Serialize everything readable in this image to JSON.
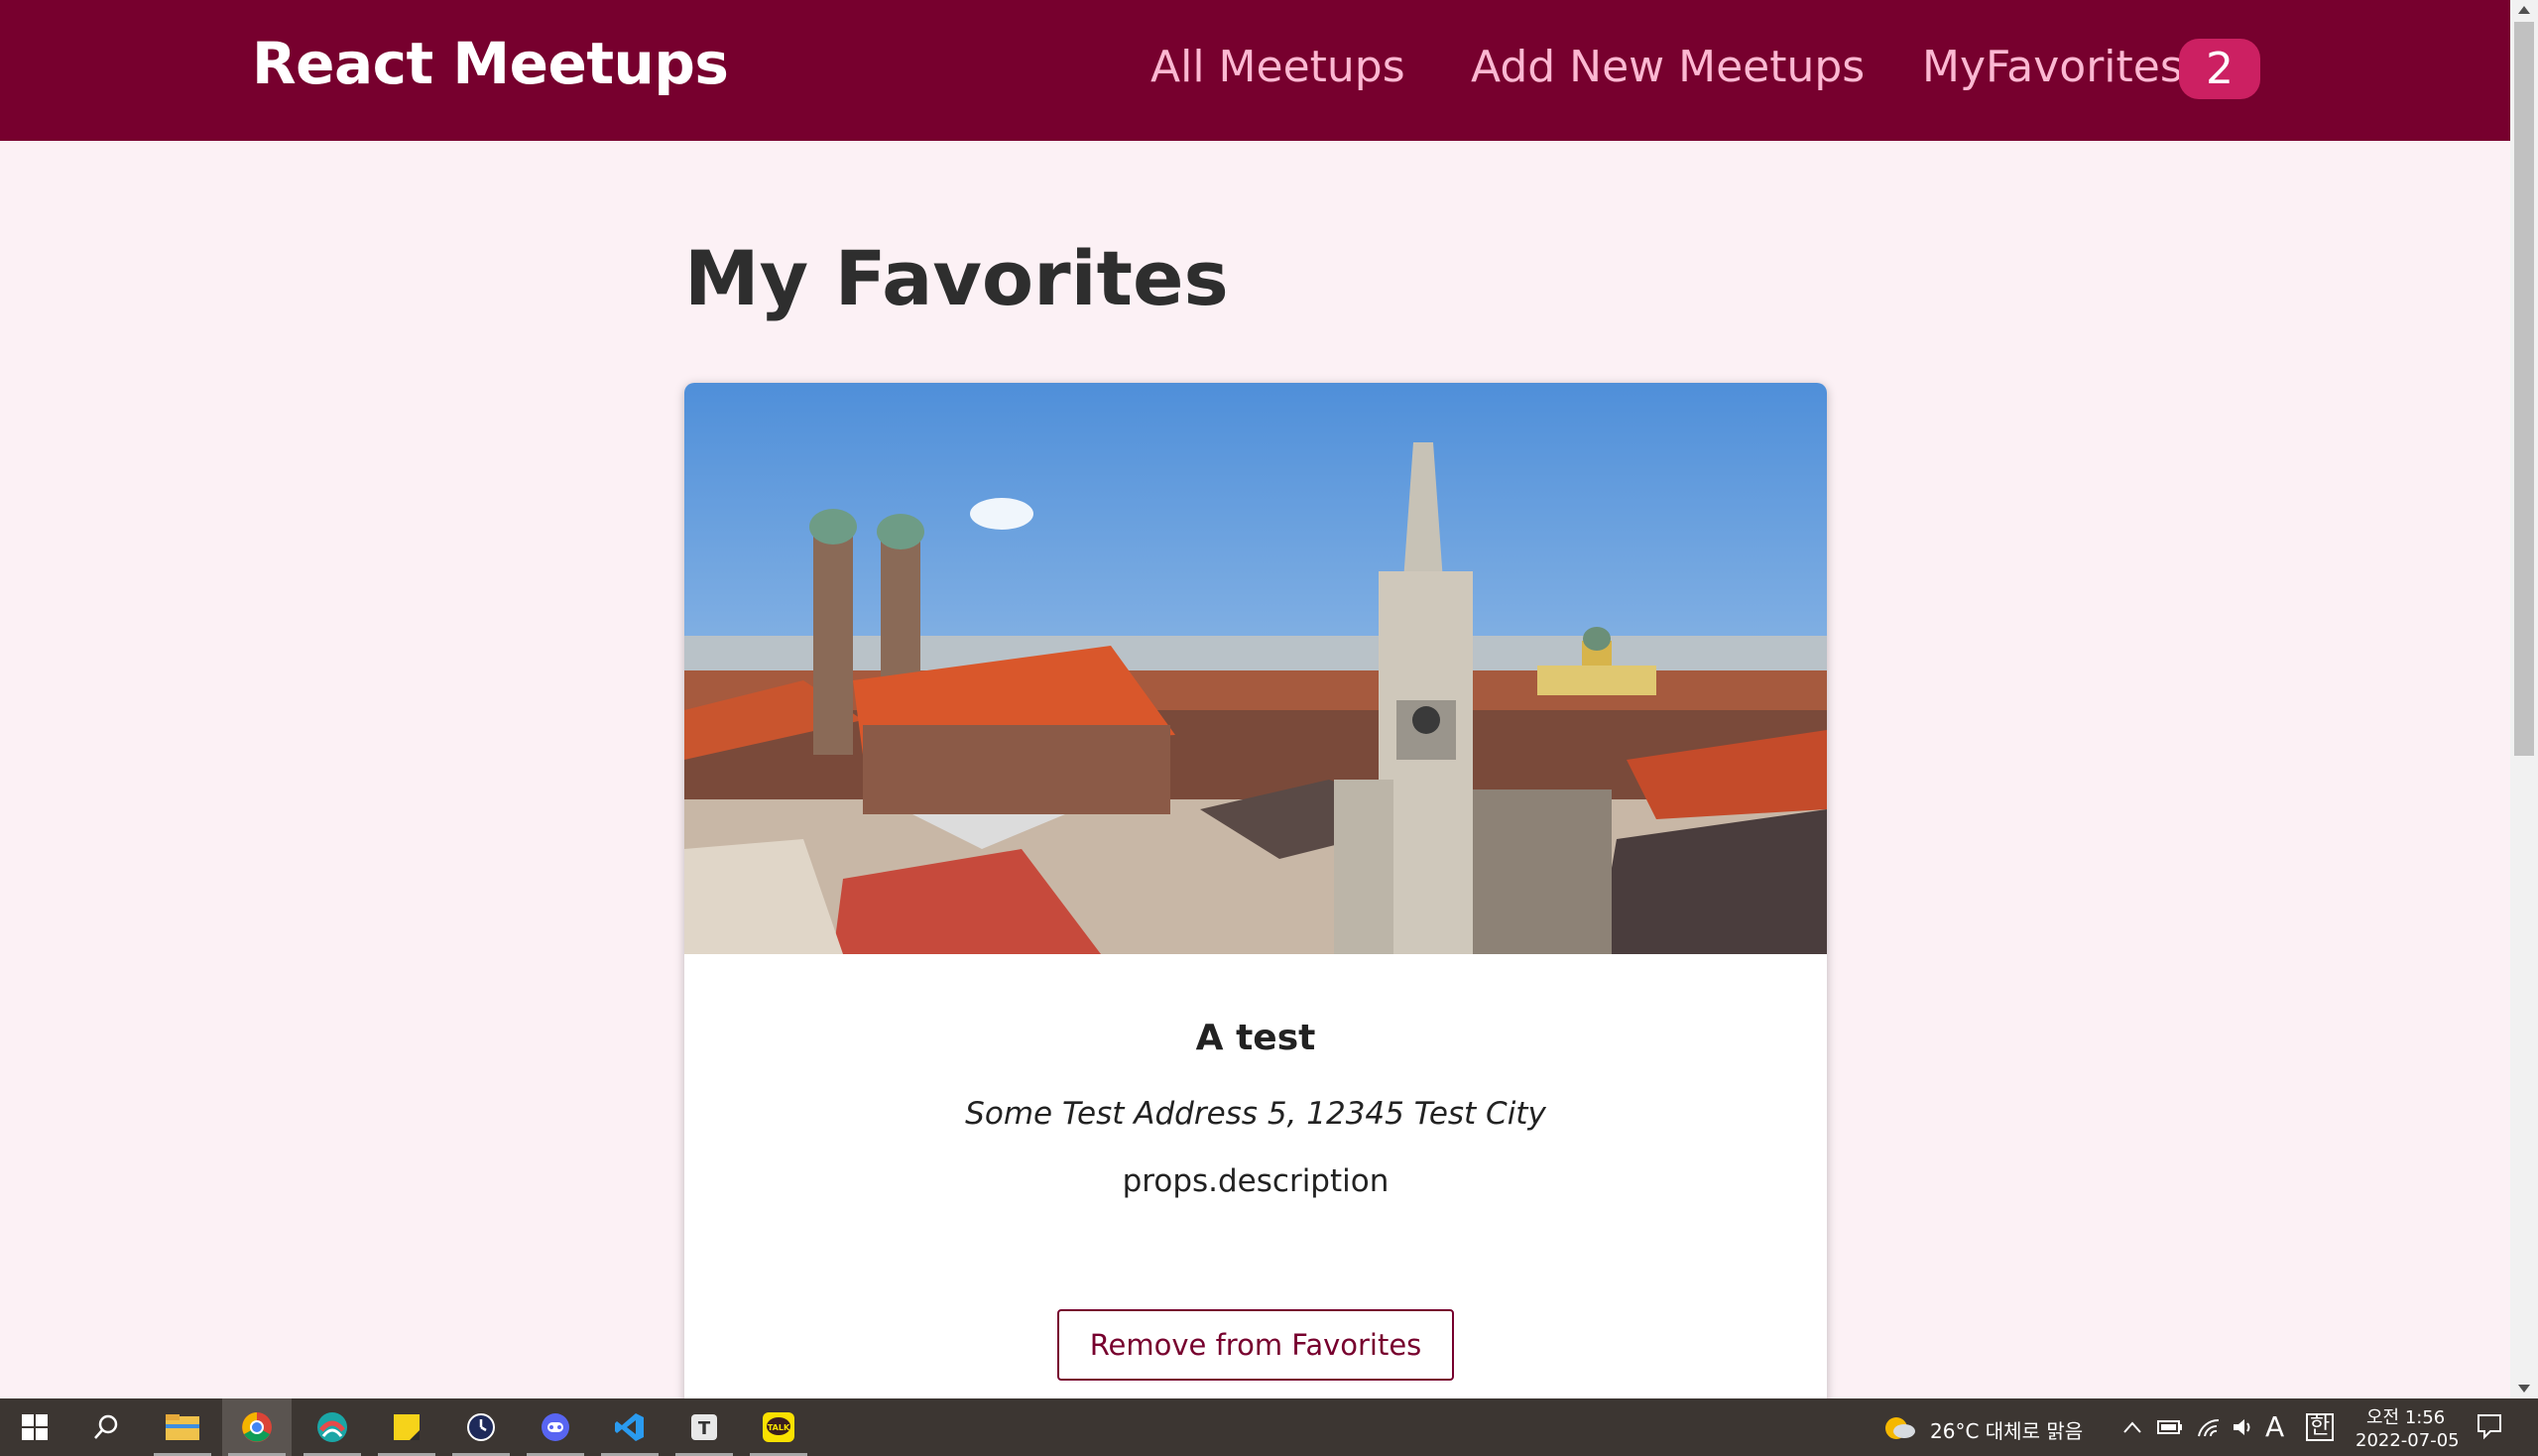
{
  "header": {
    "logo": "React Meetups",
    "nav": {
      "all_meetups": "All Meetups",
      "add_new": "Add New Meetups",
      "favorites": "MyFavorites",
      "favorites_count": "2"
    }
  },
  "page": {
    "title": "My Favorites"
  },
  "meetups": [
    {
      "title": "A test",
      "address": "Some Test Address 5, 12345 Test City",
      "description": "props.description",
      "action_label": "Remove from Favorites"
    }
  ],
  "taskbar": {
    "apps": [
      "windows-start",
      "search",
      "file-explorer",
      "chrome",
      "app-swirl",
      "sticky-notes",
      "clock-app",
      "discord",
      "vscode",
      "typora",
      "kakaotalk"
    ],
    "weather": "26°C  대체로 맑음",
    "time": "오전 1:56",
    "date": "2022-07-05",
    "ime_lang": "A",
    "ime_mode": "한"
  },
  "colors": {
    "header_bg": "#77002e",
    "nav_text": "#fcb8d2",
    "badge_bg": "#cc2062",
    "page_bg": "#fcf1f5",
    "accent": "#77002e"
  }
}
